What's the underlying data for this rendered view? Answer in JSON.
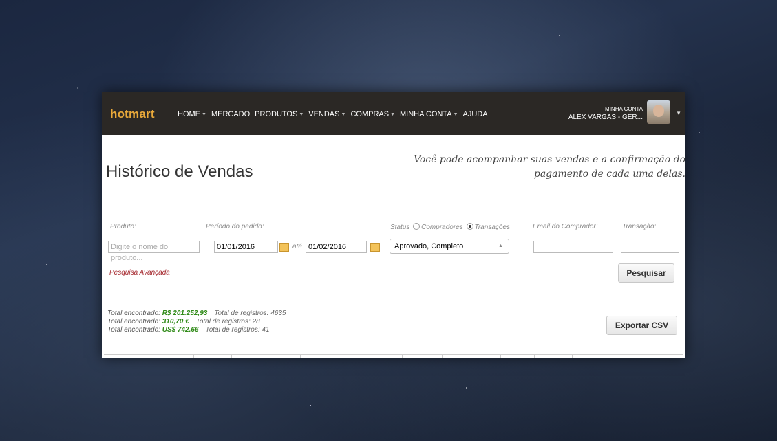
{
  "brand": "hotmart",
  "nav": [
    {
      "label": "HOME",
      "dropdown": true
    },
    {
      "label": "MERCADO",
      "dropdown": false
    },
    {
      "label": "PRODUTOS",
      "dropdown": true
    },
    {
      "label": "VENDAS",
      "dropdown": true
    },
    {
      "label": "COMPRAS",
      "dropdown": true
    },
    {
      "label": "MINHA CONTA",
      "dropdown": true
    },
    {
      "label": "AJUDA",
      "dropdown": false
    }
  ],
  "account": {
    "label": "MINHA CONTA",
    "user": "ALEX VARGAS - GER..."
  },
  "page": {
    "title": "Histórico de Vendas",
    "subtitle": "Você pode acompanhar suas vendas e a confirmação do pagamento de cada uma delas."
  },
  "filters": {
    "produto_label": "Produto:",
    "produto_placeholder": "Digite o nome do produto...",
    "periodo_label": "Período do pedido:",
    "date_from": "01/01/2016",
    "ate_label": "até",
    "date_to": "01/02/2016",
    "status_label": "Status",
    "radio_compradores": "Compradores",
    "radio_transacoes": "Transações",
    "status_value": "Aprovado, Completo",
    "email_label": "Email do Comprador:",
    "transacao_label": "Transação:",
    "email_value": "",
    "transacao_value": ""
  },
  "advanced_search": "Pesquisa Avançada",
  "search_button": "Pesquisar",
  "export_button": "Exportar CSV",
  "totals": [
    {
      "label": "Total encontrado:",
      "amount": "R$ 201.252,93",
      "records": "Total de registros: 4635"
    },
    {
      "label": "Total encontrado:",
      "amount": "310,70 €",
      "records": "Total de registros: 28"
    },
    {
      "label": "Total encontrado:",
      "amount": "US$ 742.66",
      "records": "Total de registros: 41"
    }
  ]
}
